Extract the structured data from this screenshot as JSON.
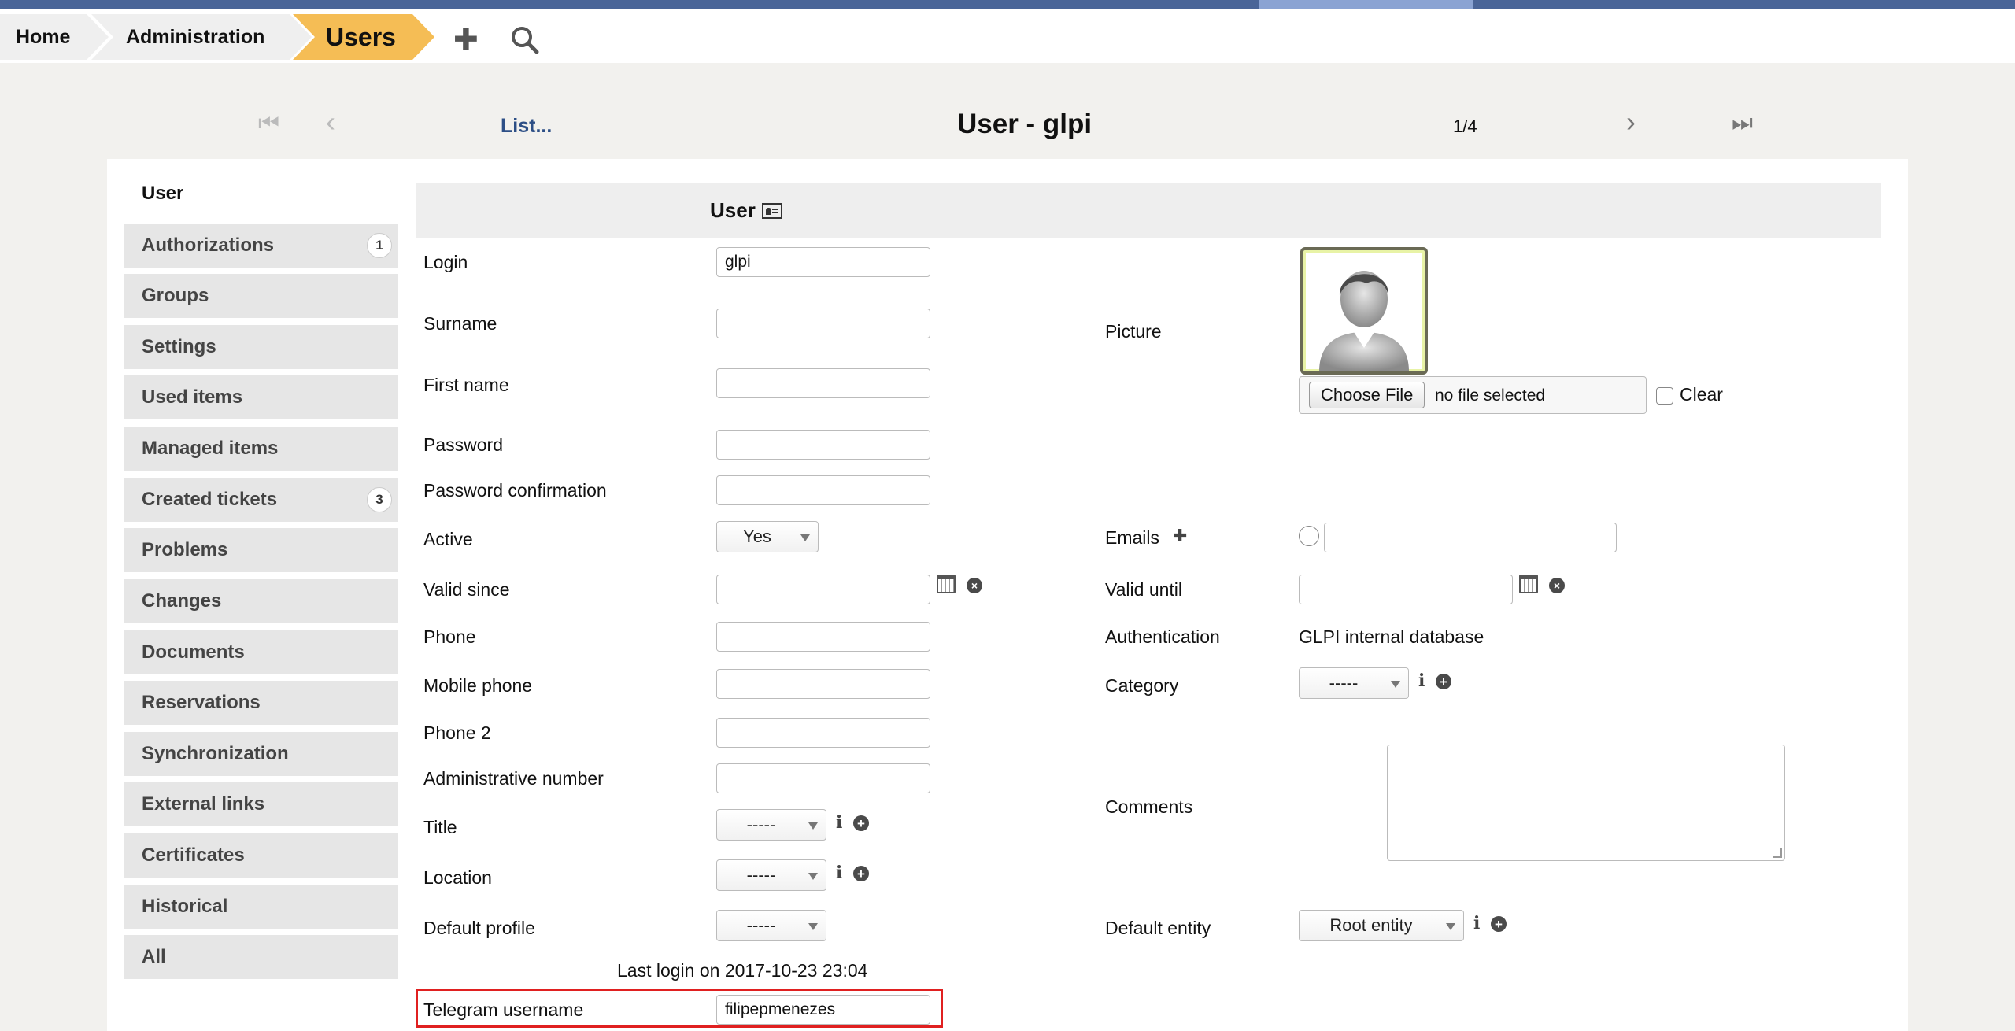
{
  "breadcrumb": {
    "home": "Home",
    "administration": "Administration",
    "current": "Users"
  },
  "header_icons": {
    "add": "plus-icon",
    "search": "search-icon"
  },
  "nav": {
    "first_icon": "first-page-icon",
    "prev_icon": "prev-icon",
    "list_link": "List...",
    "title": "User - glpi",
    "counter": "1/4",
    "next_icon": "next-icon",
    "last_icon": "last-page-icon"
  },
  "sidebar": {
    "items": [
      {
        "label": "User",
        "badge": ""
      },
      {
        "label": "Authorizations",
        "badge": "1"
      },
      {
        "label": "Groups",
        "badge": ""
      },
      {
        "label": "Settings",
        "badge": ""
      },
      {
        "label": "Used items",
        "badge": ""
      },
      {
        "label": "Managed items",
        "badge": ""
      },
      {
        "label": "Created tickets",
        "badge": "3"
      },
      {
        "label": "Problems",
        "badge": ""
      },
      {
        "label": "Changes",
        "badge": ""
      },
      {
        "label": "Documents",
        "badge": ""
      },
      {
        "label": "Reservations",
        "badge": ""
      },
      {
        "label": "Synchronization",
        "badge": ""
      },
      {
        "label": "External links",
        "badge": ""
      },
      {
        "label": "Certificates",
        "badge": ""
      },
      {
        "label": "Historical",
        "badge": ""
      },
      {
        "label": "All",
        "badge": ""
      }
    ]
  },
  "form": {
    "section_title": "User",
    "login": {
      "label": "Login",
      "value": "glpi"
    },
    "surname": {
      "label": "Surname",
      "value": ""
    },
    "first_name": {
      "label": "First name",
      "value": ""
    },
    "password": {
      "label": "Password",
      "value": ""
    },
    "password_confirmation": {
      "label": "Password confirmation",
      "value": ""
    },
    "active": {
      "label": "Active",
      "value": "Yes"
    },
    "valid_since": {
      "label": "Valid since",
      "value": ""
    },
    "phone": {
      "label": "Phone",
      "value": ""
    },
    "mobile_phone": {
      "label": "Mobile phone",
      "value": ""
    },
    "phone2": {
      "label": "Phone 2",
      "value": ""
    },
    "administrative_number": {
      "label": "Administrative number",
      "value": ""
    },
    "title": {
      "label": "Title",
      "value": "-----"
    },
    "location": {
      "label": "Location",
      "value": "-----"
    },
    "default_profile": {
      "label": "Default profile",
      "value": "-----"
    },
    "last_login": "Last login on 2017-10-23 23:04",
    "telegram": {
      "label": "Telegram username",
      "value": "filipepmenezes"
    },
    "picture": {
      "label": "Picture",
      "choose_file": "Choose File",
      "file_status": "no file selected",
      "clear_label": "Clear"
    },
    "emails": {
      "label": "Emails",
      "value": ""
    },
    "valid_until": {
      "label": "Valid until",
      "value": ""
    },
    "authentication": {
      "label": "Authentication",
      "value": "GLPI internal database"
    },
    "category": {
      "label": "Category",
      "value": "-----"
    },
    "comments": {
      "label": "Comments",
      "value": ""
    },
    "default_entity": {
      "label": "Default entity",
      "value": "Root entity"
    }
  },
  "colors": {
    "accent_breadcrumb": "#f5bd55",
    "top_bar": "#4a6598",
    "link": "#2d4f86",
    "highlight_border": "#e02020"
  }
}
